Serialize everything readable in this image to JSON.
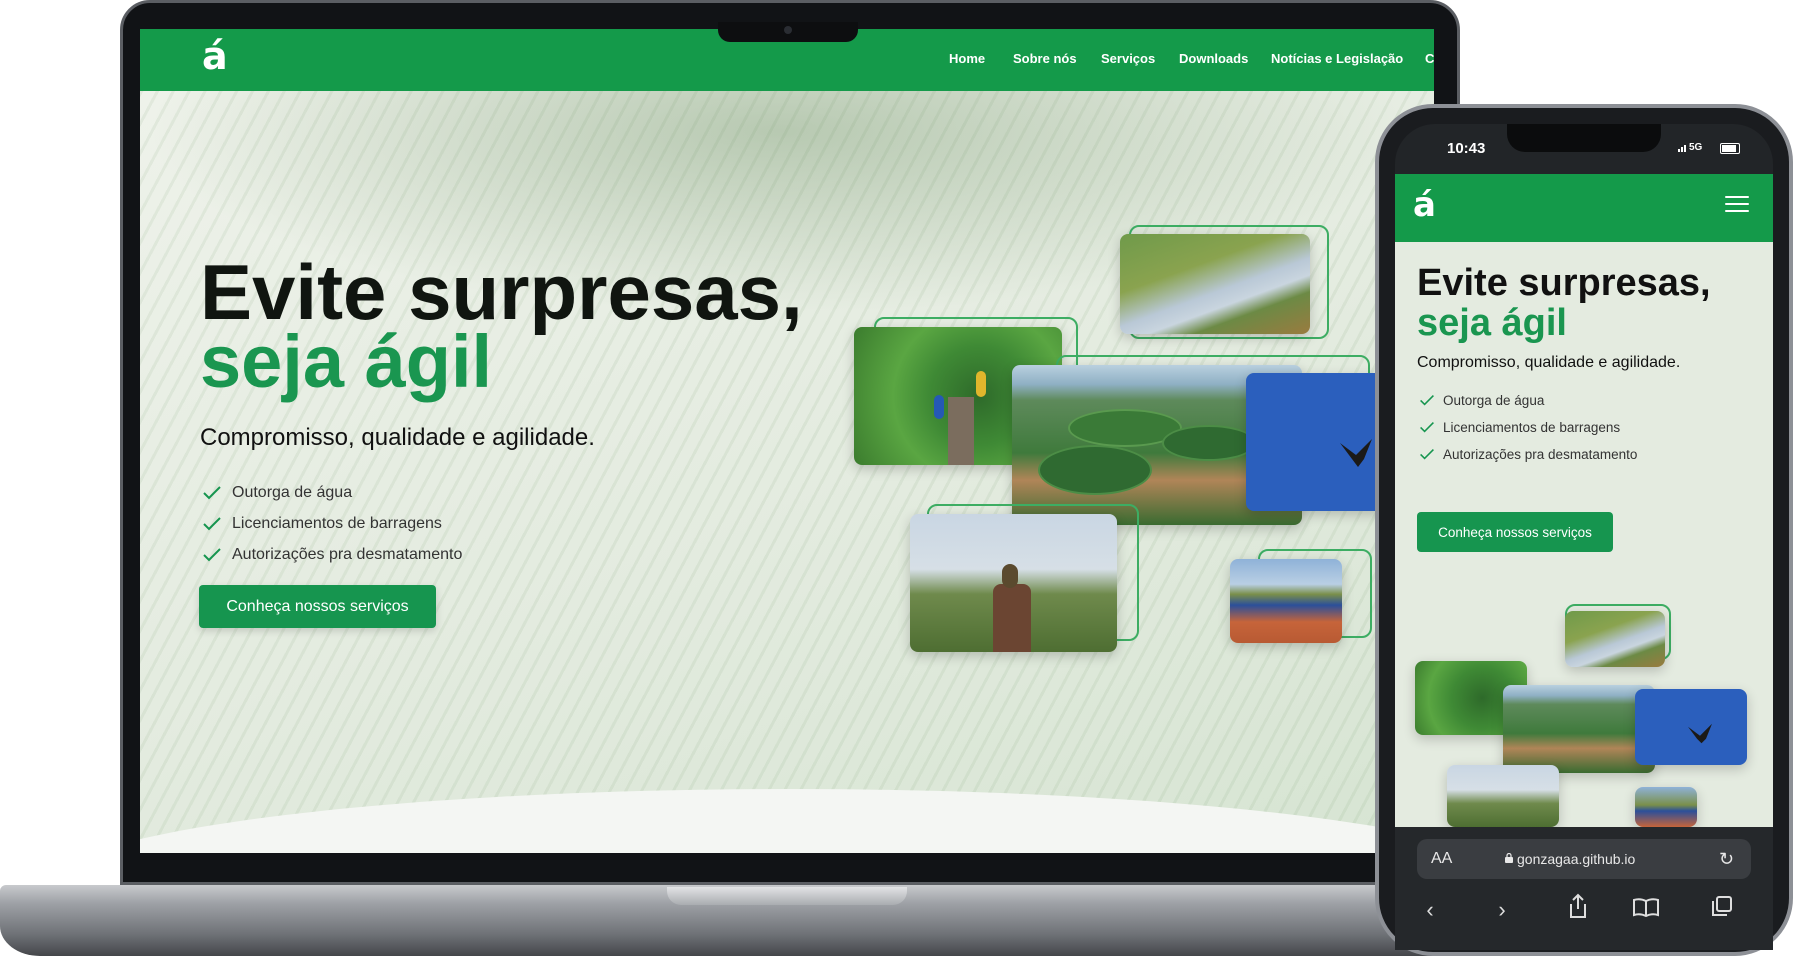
{
  "site": {
    "logo_text": "á",
    "nav": [
      "Home",
      "Sobre nós",
      "Serviços",
      "Downloads",
      "Notícias e Legislação",
      "C"
    ],
    "hero": {
      "title_line1": "Evite surpresas,",
      "title_line2": "seja ágil",
      "subtitle": "Compromisso, qualidade e agilidade.",
      "checklist": [
        "Outorga de água",
        "Licenciamentos de barragens",
        "Autorizações pra desmatamento"
      ],
      "cta_label": "Conheça nossos serviços"
    }
  },
  "phone": {
    "status_time": "10:43",
    "network": "5G",
    "url_aa": "AA",
    "url": "gonzagaa.github.io"
  },
  "colors": {
    "brand_green": "#149a4a",
    "title_green": "#1a9650",
    "button_green": "#16954f"
  },
  "icons": {
    "check": "check-icon",
    "menu": "hamburger-menu-icon",
    "lock": "lock-icon",
    "reload": "reload-icon",
    "back": "chevron-left-icon",
    "forward": "chevron-right-icon",
    "share": "share-icon",
    "bookmarks": "book-icon",
    "tabs": "tabs-icon"
  }
}
